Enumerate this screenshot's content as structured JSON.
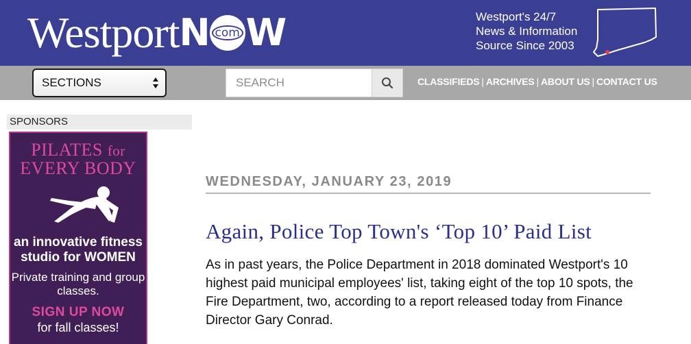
{
  "header": {
    "logo_westport": "Westport",
    "logo_n": "N",
    "logo_com": "com",
    "logo_w": "W",
    "tagline": [
      "Westport's 24/7",
      "News & Information",
      "Source Since 2003"
    ]
  },
  "nav": {
    "sections_label": "SECTIONS",
    "search_placeholder": "SEARCH",
    "links": [
      "CLASSIFIEDS",
      "ARCHIVES",
      "ABOUT US",
      "CONTACT US"
    ],
    "separator": "|"
  },
  "sidebar": {
    "heading": "SPONSORS",
    "ad": {
      "title_line1": "PILATES",
      "title_for": "for",
      "title_line2": "EVERY BODY",
      "line1": "an innovative fitness studio for WOMEN",
      "line2": "Private training and group classes.",
      "cta": "SIGN UP NOW",
      "cta2": "for fall classes!"
    }
  },
  "article": {
    "date": "WEDNESDAY, JANUARY 23, 2019",
    "headline": "Again, Police Top Town's ‘Top 10’ Paid List",
    "body": "As in past years, the Police Department in 2018 dominated Westport's 10 highest paid municipal employees' list, taking eight of the top 10 spots, the Fire Department, two, according to a report released today from Finance Director Gary Conrad."
  },
  "colors": {
    "masthead": "#3a3f94",
    "navbar": "#a8a8a8",
    "headline": "#2b2f8a",
    "ad_background": "#3f1f55",
    "ad_accent": "#e04a9e"
  }
}
